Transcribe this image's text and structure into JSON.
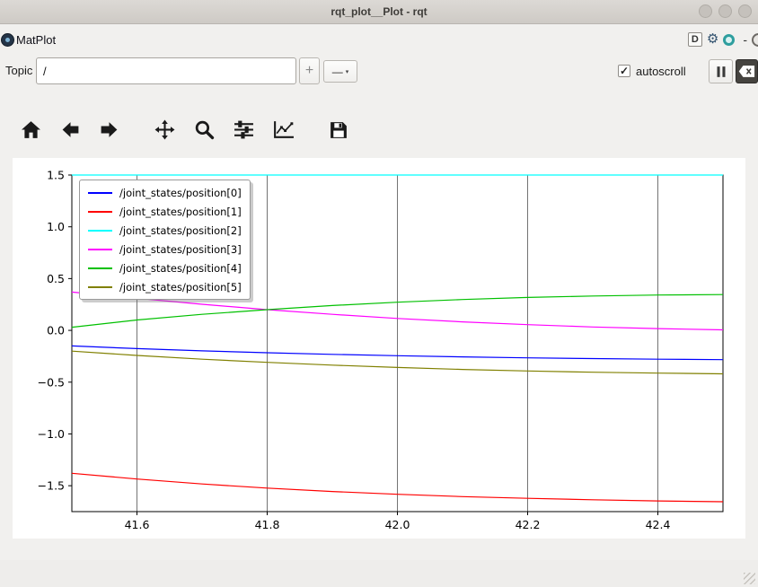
{
  "titlebar": {
    "title": "rqt_plot__Plot - rqt"
  },
  "plugin_bar": {
    "title": "MatPlot",
    "badge": "D",
    "minimize_glyph": "-"
  },
  "icons": {
    "gear": "⚙",
    "dropdown_arrow": "▾",
    "line_style": "—",
    "checkbox_check": "✓"
  },
  "topic_bar": {
    "label": "Topic",
    "input_value": "/",
    "add_button_label": "+",
    "autoscroll_label": "autoscroll",
    "autoscroll_checked": true
  },
  "toolbar": {
    "buttons": [
      "home",
      "back",
      "forward",
      "pan",
      "zoom",
      "configure-subplots",
      "plot-options",
      "save"
    ]
  },
  "chart_data": {
    "type": "line",
    "title": "",
    "xlabel": "",
    "ylabel": "",
    "xlim": [
      41.5,
      42.5
    ],
    "ylim": [
      -1.75,
      1.5
    ],
    "x_ticks": [
      41.6,
      41.8,
      42.0,
      42.2,
      42.4
    ],
    "y_ticks": [
      1.5,
      1.0,
      0.5,
      0.0,
      -0.5,
      -1.0,
      -1.5
    ],
    "grid": "vertical-only",
    "legend_position": "upper-left",
    "x": [
      41.5,
      41.6,
      41.7,
      41.8,
      41.9,
      42.0,
      42.1,
      42.2,
      42.3,
      42.4,
      42.5
    ],
    "series": [
      {
        "name": "/joint_states/position[0]",
        "color": "#0000ff",
        "values": [
          -0.15,
          -0.176,
          -0.198,
          -0.216,
          -0.232,
          -0.245,
          -0.256,
          -0.265,
          -0.272,
          -0.278,
          -0.283
        ]
      },
      {
        "name": "/joint_states/position[1]",
        "color": "#ff0000",
        "values": [
          -1.38,
          -1.435,
          -1.483,
          -1.523,
          -1.556,
          -1.583,
          -1.605,
          -1.622,
          -1.636,
          -1.647,
          -1.655
        ]
      },
      {
        "name": "/joint_states/position[2]",
        "color": "#00ffff",
        "values": [
          1.5,
          1.5,
          1.5,
          1.5,
          1.5,
          1.5,
          1.5,
          1.5,
          1.5,
          1.5,
          1.5
        ]
      },
      {
        "name": "/joint_states/position[3]",
        "color": "#ff00ff",
        "values": [
          0.37,
          0.31,
          0.252,
          0.2,
          0.155,
          0.115,
          0.082,
          0.055,
          0.033,
          0.017,
          0.005
        ]
      },
      {
        "name": "/joint_states/position[4]",
        "color": "#00c000",
        "values": [
          0.03,
          0.1,
          0.155,
          0.2,
          0.24,
          0.272,
          0.298,
          0.318,
          0.332,
          0.341,
          0.346
        ]
      },
      {
        "name": "/joint_states/position[5]",
        "color": "#808000",
        "values": [
          -0.2,
          -0.242,
          -0.278,
          -0.309,
          -0.336,
          -0.358,
          -0.377,
          -0.392,
          -0.404,
          -0.413,
          -0.42
        ]
      }
    ]
  }
}
